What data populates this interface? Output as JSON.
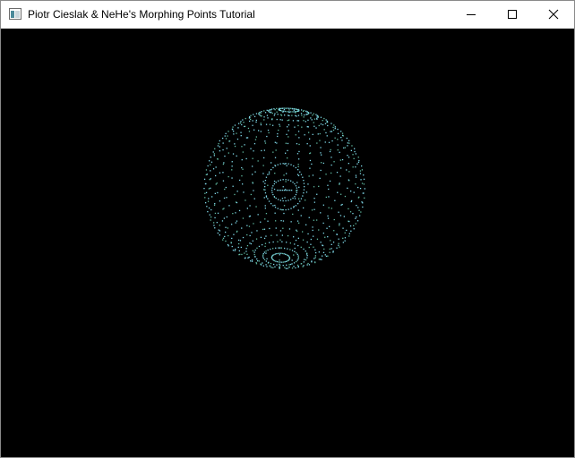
{
  "window": {
    "title": "Piotr Cieslak & NeHe's Morphing Points Tutorial",
    "icon": "app-window-icon",
    "controls": {
      "minimize": "minimize-icon",
      "maximize": "maximize-icon",
      "close": "close-icon"
    }
  },
  "scene": {
    "background_color": "#000000",
    "point_color_primary": "#7fd8e8",
    "point_color_secondary": "#5fb9a0",
    "shape": "sphere-points"
  }
}
